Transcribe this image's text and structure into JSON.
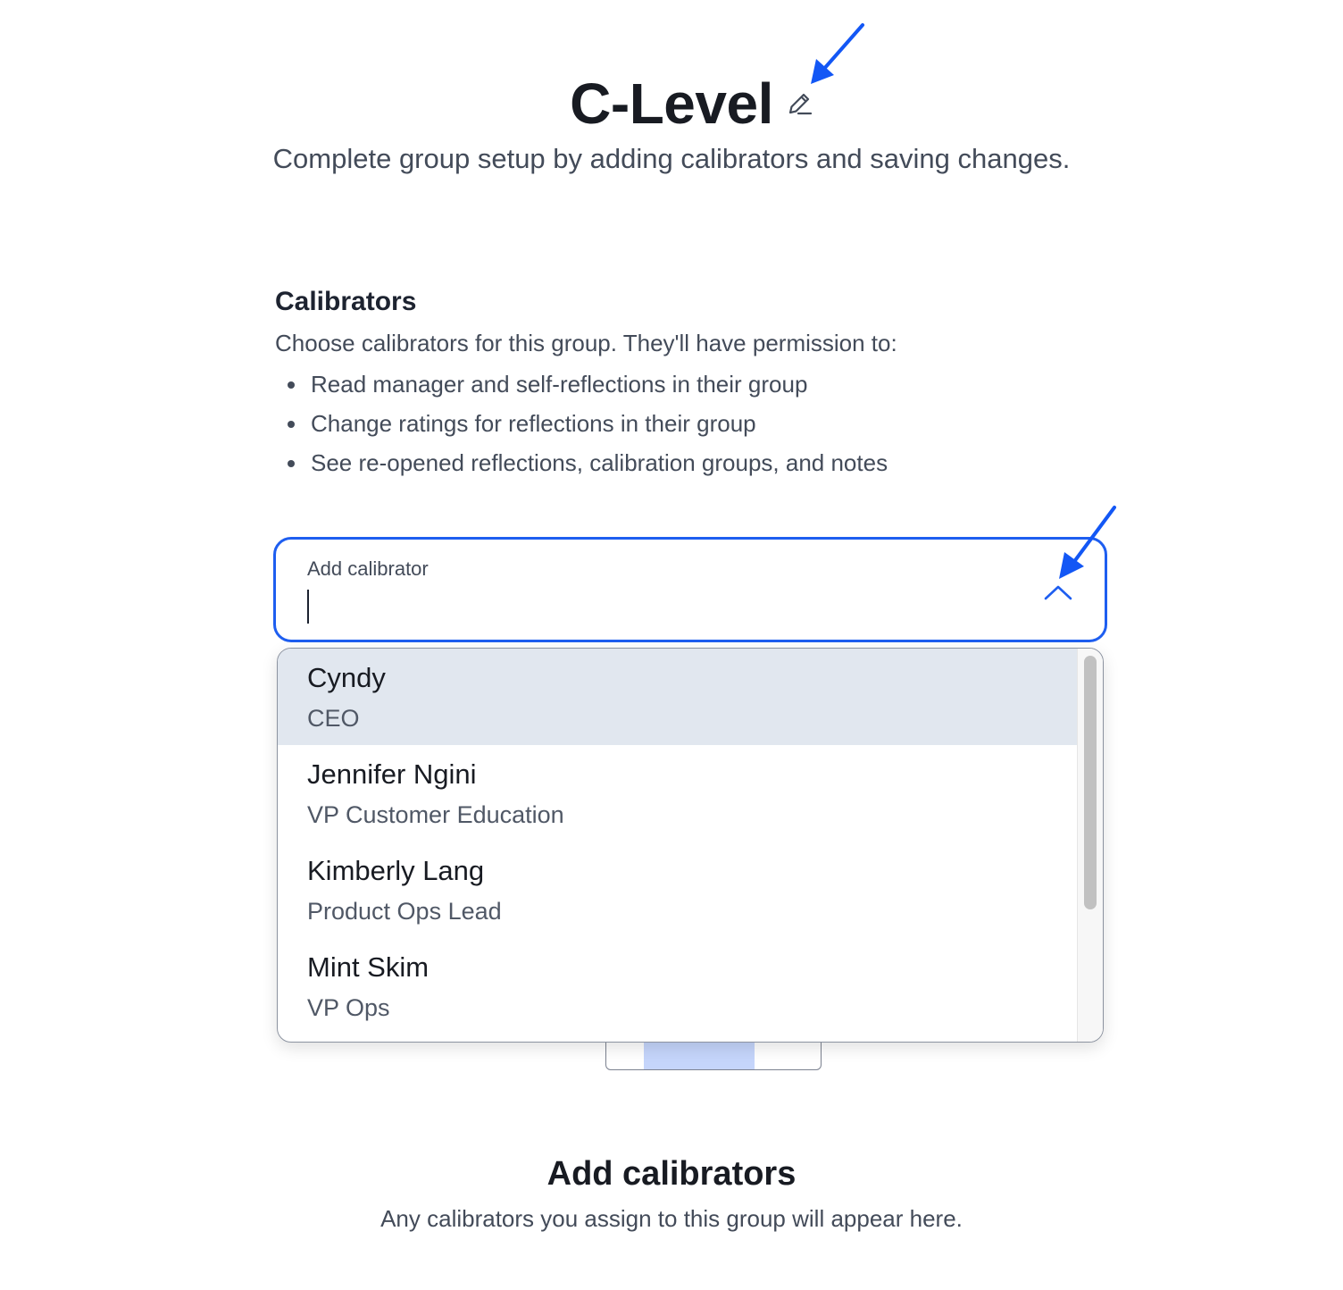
{
  "header": {
    "title": "C-Level",
    "edit_icon": "pencil-icon",
    "subtitle": "Complete group setup by adding calibrators and saving changes."
  },
  "calibrators": {
    "heading": "Calibrators",
    "description": "Choose calibrators for this group. They'll have permission to:",
    "permissions": [
      "Read manager and self-reflections in their group",
      "Change ratings for reflections in their group",
      "See re-opened reflections, calibration groups, and notes"
    ]
  },
  "combobox": {
    "label": "Add calibrator",
    "value": "",
    "toggle_icon": "chevron-up-icon",
    "expanded": true,
    "accent_color": "#1e5ef0"
  },
  "options": [
    {
      "name": "Cyndy",
      "role": "CEO",
      "highlighted": true
    },
    {
      "name": "Jennifer Ngini",
      "role": "VP Customer Education",
      "highlighted": false
    },
    {
      "name": "Kimberly Lang",
      "role": "Product Ops Lead",
      "highlighted": false
    },
    {
      "name": "Mint Skim",
      "role": "VP Ops",
      "highlighted": false
    }
  ],
  "empty_state": {
    "title": "Add calibrators",
    "description": "Any calibrators you assign to this group will appear here."
  },
  "annotations": {
    "arrow_color": "#1357f5"
  }
}
